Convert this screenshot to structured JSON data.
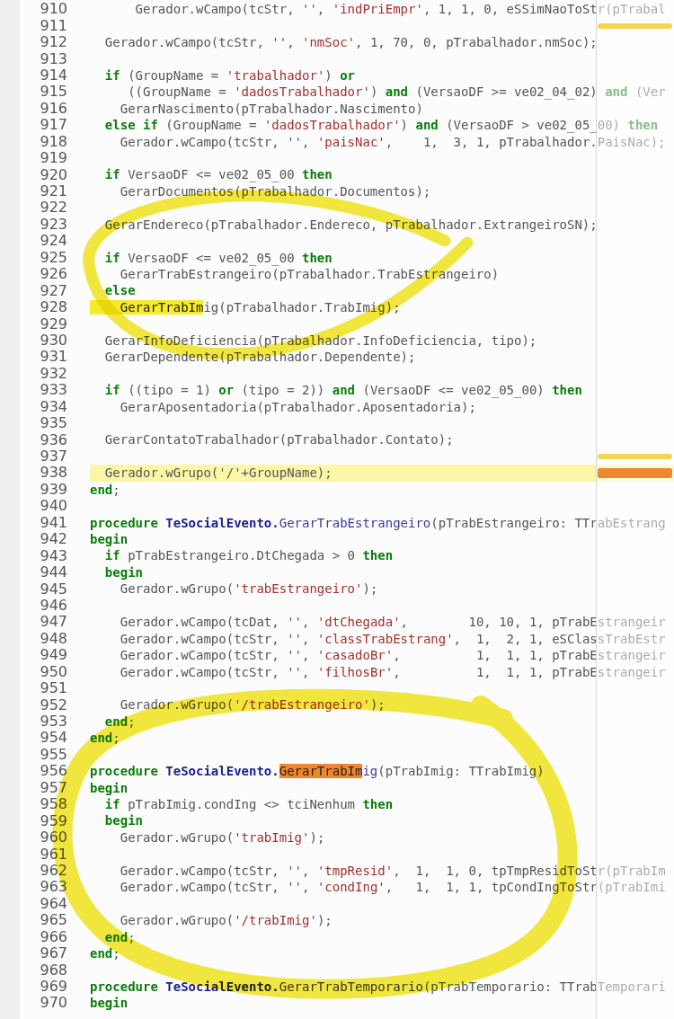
{
  "lines": [
    {
      "number": "910",
      "current": false,
      "tokens": [
        {
          "kind": "plain",
          "text": "      Gerador.wCampo(tcStr, '', "
        },
        {
          "kind": "string",
          "text": "'indPriEmpr'"
        },
        {
          "kind": "plain",
          "text": ", 1, 1, 0, eSSimNaoToStr(pTrabal"
        }
      ]
    },
    {
      "number": "911",
      "current": false,
      "ruler_marker": {
        "color": "#f2d64b"
      }
    },
    {
      "number": "912",
      "current": false,
      "tokens": [
        {
          "kind": "plain",
          "text": "  Gerador.wCampo(tcStr, '', "
        },
        {
          "kind": "string",
          "text": "'nmSoc'"
        },
        {
          "kind": "plain",
          "text": ", 1, 70, 0, pTrabalhador.nmSoc);"
        }
      ]
    },
    {
      "number": "913",
      "current": false
    },
    {
      "number": "914",
      "current": false,
      "tokens": [
        {
          "kind": "keyword",
          "text": "  if"
        },
        {
          "kind": "plain",
          "text": " (GroupName = "
        },
        {
          "kind": "string",
          "text": "'trabalhador'"
        },
        {
          "kind": "plain",
          "text": ") "
        },
        {
          "kind": "keyword",
          "text": "or"
        }
      ]
    },
    {
      "number": "915",
      "current": false,
      "tokens": [
        {
          "kind": "plain",
          "text": "     ((GroupName = "
        },
        {
          "kind": "string",
          "text": "'dadosTrabalhador'"
        },
        {
          "kind": "plain",
          "text": ") "
        },
        {
          "kind": "keyword",
          "text": "and"
        },
        {
          "kind": "plain",
          "text": " (VersaoDF >= ve02_04_02) "
        },
        {
          "kind": "keyword",
          "text": "and"
        },
        {
          "kind": "plain",
          "text": " (Ver"
        }
      ]
    },
    {
      "number": "916",
      "current": false,
      "tokens": [
        {
          "kind": "plain",
          "text": "    GerarNascimento(pTrabalhador.Nascimento)"
        }
      ]
    },
    {
      "number": "917",
      "current": false,
      "tokens": [
        {
          "kind": "keyword",
          "text": "  else if"
        },
        {
          "kind": "plain",
          "text": " (GroupName = "
        },
        {
          "kind": "string",
          "text": "'dadosTrabalhador'"
        },
        {
          "kind": "plain",
          "text": ") "
        },
        {
          "kind": "keyword",
          "text": "and"
        },
        {
          "kind": "plain",
          "text": " (VersaoDF > ve02_05_00) "
        },
        {
          "kind": "keyword",
          "text": "then"
        }
      ]
    },
    {
      "number": "918",
      "current": false,
      "tokens": [
        {
          "kind": "plain",
          "text": "    Gerador.wCampo(tcStr, '', "
        },
        {
          "kind": "string",
          "text": "'paisNac'"
        },
        {
          "kind": "plain",
          "text": ",    1,  3, 1, pTrabalhador.PaisNac);"
        }
      ]
    },
    {
      "number": "919",
      "current": false
    },
    {
      "number": "920",
      "current": false,
      "tokens": [
        {
          "kind": "keyword",
          "text": "  if"
        },
        {
          "kind": "plain",
          "text": " VersaoDF <= ve02_05_00 "
        },
        {
          "kind": "keyword",
          "text": "then"
        }
      ]
    },
    {
      "number": "921",
      "current": false,
      "tokens": [
        {
          "kind": "plain",
          "text": "    GerarDocumentos(pTrabalhador.Documentos);"
        }
      ]
    },
    {
      "number": "922",
      "current": false
    },
    {
      "number": "923",
      "current": false,
      "tokens": [
        {
          "kind": "plain",
          "text": "  GerarEndereco(pTrabalhador.Endereco, pTrabalhador.ExtrangeiroSN);"
        }
      ]
    },
    {
      "number": "924",
      "current": false
    },
    {
      "number": "925",
      "current": false,
      "tokens": [
        {
          "kind": "keyword",
          "text": "  if"
        },
        {
          "kind": "plain",
          "text": " VersaoDF <= ve02_05_00 "
        },
        {
          "kind": "keyword",
          "text": "then"
        }
      ]
    },
    {
      "number": "926",
      "current": false,
      "tokens": [
        {
          "kind": "plain",
          "text": "    GerarTrabEstrangeiro(pTrabalhador.TrabEstrangeiro)"
        }
      ]
    },
    {
      "number": "927",
      "current": false,
      "tokens": [
        {
          "kind": "keyword",
          "text": "  else"
        }
      ]
    },
    {
      "number": "928",
      "current": false,
      "tokens": [
        {
          "kind": "match",
          "text": "    GerarTrabIm"
        },
        {
          "kind": "plain",
          "text": "ig(pTrabalhador.TrabImig);"
        }
      ]
    },
    {
      "number": "929",
      "current": false
    },
    {
      "number": "930",
      "current": false,
      "tokens": [
        {
          "kind": "plain",
          "text": "  GerarInfoDeficiencia(pTrabalhador.InfoDeficiencia, tipo);"
        }
      ]
    },
    {
      "number": "931",
      "current": false,
      "tokens": [
        {
          "kind": "plain",
          "text": "  GerarDependente(pTrabalhador.Dependente);"
        }
      ]
    },
    {
      "number": "932",
      "current": false
    },
    {
      "number": "933",
      "current": false,
      "tokens": [
        {
          "kind": "keyword",
          "text": "  if"
        },
        {
          "kind": "plain",
          "text": " ((tipo = 1) "
        },
        {
          "kind": "keyword",
          "text": "or"
        },
        {
          "kind": "plain",
          "text": " (tipo = 2)) "
        },
        {
          "kind": "keyword",
          "text": "and"
        },
        {
          "kind": "plain",
          "text": " (VersaoDF <= ve02_05_00) "
        },
        {
          "kind": "keyword",
          "text": "then"
        }
      ]
    },
    {
      "number": "934",
      "current": false,
      "tokens": [
        {
          "kind": "plain",
          "text": "    GerarAposentadoria(pTrabalhador.Aposentadoria);"
        }
      ]
    },
    {
      "number": "935",
      "current": false
    },
    {
      "number": "936",
      "current": false,
      "tokens": [
        {
          "kind": "plain",
          "text": "  GerarContatoTrabalhador(pTrabalhador.Contato);"
        }
      ]
    },
    {
      "number": "937",
      "current": false,
      "ruler_marker": {
        "color": "#f2d64b"
      }
    },
    {
      "number": "938",
      "current": true,
      "ruler_marker": {
        "color": "#f0862e"
      },
      "tokens": [
        {
          "kind": "plain",
          "text": "  Gerador.wGrupo('/'+GroupName);"
        }
      ]
    },
    {
      "number": "939",
      "current": false,
      "tokens": [
        {
          "kind": "keyword",
          "text": "end"
        },
        {
          "kind": "plain",
          "text": ";"
        }
      ]
    },
    {
      "number": "940",
      "current": false
    },
    {
      "number": "941",
      "current": false,
      "tokens": [
        {
          "kind": "keyword",
          "text": "procedure"
        },
        {
          "kind": "type",
          "text": " TeSocialEvento."
        },
        {
          "kind": "method",
          "text": "GerarTrabEstrangeiro"
        },
        {
          "kind": "plain",
          "text": "(pTrabEstrangeiro: TTrabEstrang"
        }
      ]
    },
    {
      "number": "942",
      "current": false,
      "tokens": [
        {
          "kind": "keyword",
          "text": "begin"
        }
      ]
    },
    {
      "number": "943",
      "current": false,
      "tokens": [
        {
          "kind": "keyword",
          "text": "  if"
        },
        {
          "kind": "plain",
          "text": " pTrabEstrangeiro.DtChegada > 0 "
        },
        {
          "kind": "keyword",
          "text": "then"
        }
      ]
    },
    {
      "number": "944",
      "current": false,
      "tokens": [
        {
          "kind": "keyword",
          "text": "  begin"
        }
      ]
    },
    {
      "number": "945",
      "current": false,
      "tokens": [
        {
          "kind": "plain",
          "text": "    Gerador.wGrupo("
        },
        {
          "kind": "string",
          "text": "'trabEstrangeiro'"
        },
        {
          "kind": "plain",
          "text": ");"
        }
      ]
    },
    {
      "number": "946",
      "current": false
    },
    {
      "number": "947",
      "current": false,
      "tokens": [
        {
          "kind": "plain",
          "text": "    Gerador.wCampo(tcDat, '', "
        },
        {
          "kind": "string",
          "text": "'dtChegada'"
        },
        {
          "kind": "plain",
          "text": ",        10, 10, 1, pTrabEstrangeir"
        }
      ]
    },
    {
      "number": "948",
      "current": false,
      "tokens": [
        {
          "kind": "plain",
          "text": "    Gerador.wCampo(tcStr, '', "
        },
        {
          "kind": "string",
          "text": "'classTrabEstrang'"
        },
        {
          "kind": "plain",
          "text": ",  1,  2, 1, eSClassTrabEstr"
        }
      ]
    },
    {
      "number": "949",
      "current": false,
      "tokens": [
        {
          "kind": "plain",
          "text": "    Gerador.wCampo(tcStr, '', "
        },
        {
          "kind": "string",
          "text": "'casadoBr'"
        },
        {
          "kind": "plain",
          "text": ",          1,  1, 1, pTrabEstrangeir"
        }
      ]
    },
    {
      "number": "950",
      "current": false,
      "tokens": [
        {
          "kind": "plain",
          "text": "    Gerador.wCampo(tcStr, '', "
        },
        {
          "kind": "string",
          "text": "'filhosBr'"
        },
        {
          "kind": "plain",
          "text": ",          1,  1, 1, pTrabEstrangeir"
        }
      ]
    },
    {
      "number": "951",
      "current": false
    },
    {
      "number": "952",
      "current": false,
      "tokens": [
        {
          "kind": "plain",
          "text": "    Gerador.wGrupo("
        },
        {
          "kind": "string",
          "text": "'/trabEstrangeiro'"
        },
        {
          "kind": "plain",
          "text": ");"
        }
      ]
    },
    {
      "number": "953",
      "current": false,
      "tokens": [
        {
          "kind": "keyword",
          "text": "  end"
        },
        {
          "kind": "plain",
          "text": ";"
        }
      ]
    },
    {
      "number": "954",
      "current": false,
      "tokens": [
        {
          "kind": "keyword",
          "text": "end"
        },
        {
          "kind": "plain",
          "text": ";"
        }
      ]
    },
    {
      "number": "955",
      "current": false
    },
    {
      "number": "956",
      "current": false,
      "tokens": [
        {
          "kind": "keyword",
          "text": "procedure"
        },
        {
          "kind": "type",
          "text": " TeSocialEvento."
        },
        {
          "kind": "match_current",
          "text": "GerarTrabIm"
        },
        {
          "kind": "method",
          "text": "ig"
        },
        {
          "kind": "plain",
          "text": "(pTrabImig: TTrabImig)"
        }
      ]
    },
    {
      "number": "957",
      "current": false,
      "tokens": [
        {
          "kind": "keyword",
          "text": "begin"
        }
      ]
    },
    {
      "number": "958",
      "current": false,
      "tokens": [
        {
          "kind": "keyword",
          "text": "  if"
        },
        {
          "kind": "plain",
          "text": " pTrabImig.condIng <> tciNenhum "
        },
        {
          "kind": "keyword",
          "text": "then"
        }
      ]
    },
    {
      "number": "959",
      "current": false,
      "tokens": [
        {
          "kind": "keyword",
          "text": "  begin"
        }
      ]
    },
    {
      "number": "960",
      "current": false,
      "tokens": [
        {
          "kind": "plain",
          "text": "    Gerador.wGrupo("
        },
        {
          "kind": "string",
          "text": "'trabImig'"
        },
        {
          "kind": "plain",
          "text": ");"
        }
      ]
    },
    {
      "number": "961",
      "current": false
    },
    {
      "number": "962",
      "current": false,
      "tokens": [
        {
          "kind": "plain",
          "text": "    Gerador.wCampo(tcStr, '', "
        },
        {
          "kind": "string",
          "text": "'tmpResid'"
        },
        {
          "kind": "plain",
          "text": ",  1,  1, 0, tpTmpResidToStr(pTrabIm"
        }
      ]
    },
    {
      "number": "963",
      "current": false,
      "tokens": [
        {
          "kind": "plain",
          "text": "    Gerador.wCampo(tcStr, '', "
        },
        {
          "kind": "string",
          "text": "'condIng'"
        },
        {
          "kind": "plain",
          "text": ",   1,  1, 1, tpCondIngToStr(pTrabImi"
        }
      ]
    },
    {
      "number": "964",
      "current": false
    },
    {
      "number": "965",
      "current": false,
      "tokens": [
        {
          "kind": "plain",
          "text": "    Gerador.wGrupo("
        },
        {
          "kind": "string",
          "text": "'/trabImig'"
        },
        {
          "kind": "plain",
          "text": ");"
        }
      ]
    },
    {
      "number": "966",
      "current": false,
      "tokens": [
        {
          "kind": "keyword",
          "text": "  end"
        },
        {
          "kind": "plain",
          "text": ";"
        }
      ]
    },
    {
      "number": "967",
      "current": false,
      "tokens": [
        {
          "kind": "keyword",
          "text": "end"
        },
        {
          "kind": "plain",
          "text": ";"
        }
      ]
    },
    {
      "number": "968",
      "current": false
    },
    {
      "number": "969",
      "current": false,
      "tokens": [
        {
          "kind": "keyword",
          "text": "procedure"
        },
        {
          "kind": "type",
          "text": " TeSocialEvento."
        },
        {
          "kind": "method",
          "text": "GerarTrabTemporario"
        },
        {
          "kind": "plain",
          "text": "(pTrabTemporario: TTrabTemporari"
        }
      ]
    },
    {
      "number": "970",
      "current": false,
      "tokens": [
        {
          "kind": "keyword",
          "text": "begin"
        }
      ]
    }
  ]
}
